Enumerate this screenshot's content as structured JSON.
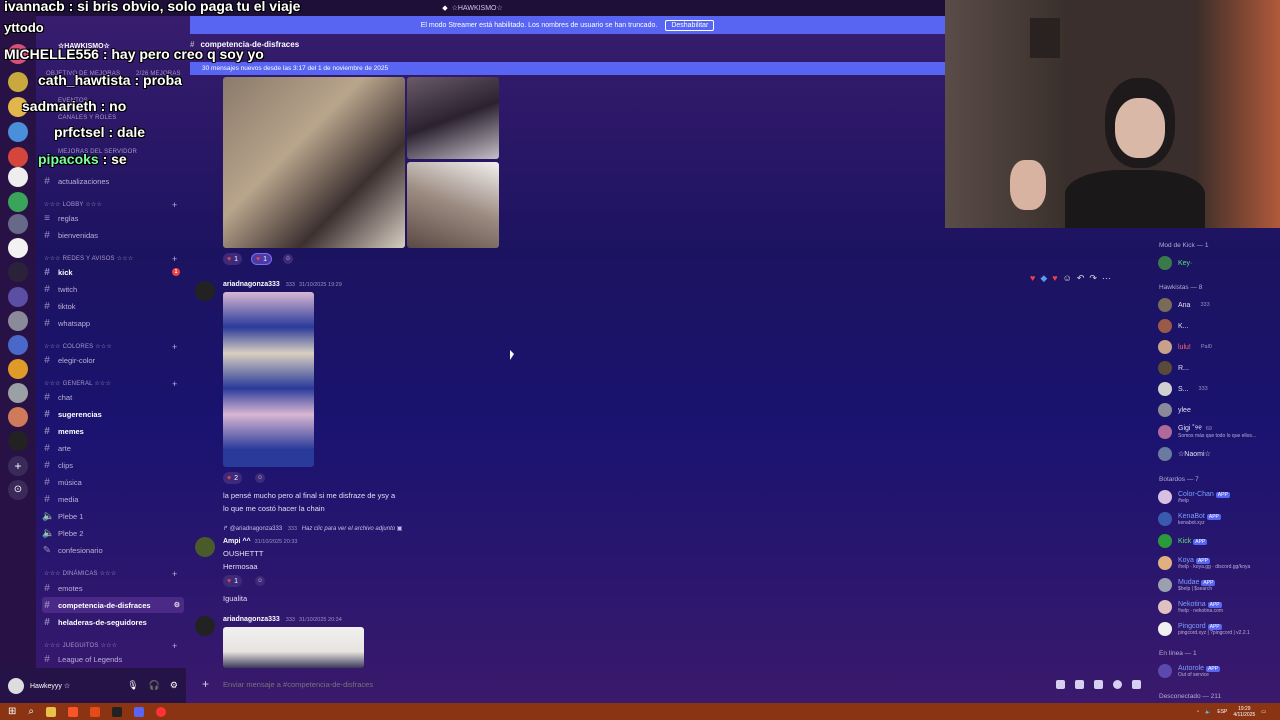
{
  "window": {
    "server_name": "☆HAWKISMO☆",
    "streamer_notice": "El modo Streamer está habilitado. Los nombres de usuario se han truncado.",
    "disable_label": "Deshabilitar"
  },
  "chat_overlay": [
    {
      "user": "ivannacb",
      "text": ": si bris obvio, solo paga tu el viaje"
    },
    {
      "user": "yttodo",
      "text": ""
    },
    {
      "user": "MICHELLE556",
      "text": ": hay pero creo q soy yo"
    },
    {
      "user": "cath_hawtista",
      "text": ": proba"
    },
    {
      "user": "sadmarieth",
      "text": ": no"
    },
    {
      "user": "prfctsel",
      "text": ": dale"
    },
    {
      "user": "pipacoks",
      "text": ": se"
    }
  ],
  "sidebar": {
    "server_title": "☆HAWKISMO☆",
    "hidden_items": [
      "Objetivo de mejoras",
      "Eventos",
      "Canales y roles",
      "Mejoras del servidor"
    ],
    "boost_count": "2/26 Mejoras",
    "categories": [
      {
        "name": "☆☆☆ LOBBY ☆☆☆"
      },
      {
        "name": "☆☆☆ REDES Y AVISOS ☆☆☆"
      },
      {
        "name": "☆☆☆ COLORES ☆☆☆"
      },
      {
        "name": "☆☆☆ GENERAL ☆☆☆"
      },
      {
        "name": "☆☆☆ DINÁMICAS ☆☆☆"
      },
      {
        "name": "☆☆☆ JUEGUITOS ☆☆☆"
      }
    ],
    "channels": [
      "actualizaciones",
      "reglas",
      "bienvenidas",
      "kick",
      "twitch",
      "tiktok",
      "whatsapp",
      "elegir-color",
      "chat",
      "sugerencias",
      "memes",
      "arte",
      "clips",
      "música",
      "media",
      "Plebe 1",
      "Plebe 2",
      "confesionario",
      "emotes",
      "competencia-de-disfraces",
      "heladeras-de-seguidores",
      "League of Legends"
    ],
    "kick_badge": "1"
  },
  "user_panel": {
    "name": "Hawkeyyy ☆"
  },
  "channel": {
    "name": "competencia-de-disfraces",
    "new_messages": "30 mensajes nuevos desde las 3:17 del 1 de noviembre de 2025",
    "composer_placeholder": "Enviar mensaje a #competencia-de-disfraces"
  },
  "messages": [
    {
      "reactions": [
        {
          "emoji": "♥",
          "count": "1"
        },
        {
          "emoji": "♥",
          "count": "1"
        }
      ]
    },
    {
      "author": "ariadnagonza333",
      "tag": "333",
      "time": "31/10/2025 19:29",
      "reactions": [
        {
          "emoji": "♥",
          "count": "2"
        }
      ],
      "text1": "la pensé mucho pero al final si me disfraze de ysy a",
      "text2": "lo que me costó hacer la chain"
    },
    {
      "reply_to": "@ariadnagonza333",
      "reply_tag": "333",
      "reply_text": "Haz clic para ver el archivo adjunto",
      "author": "Ampi ^^",
      "time": "31/10/2025 20:33",
      "text1": "OUSHETTT",
      "text2": "Hermosaa",
      "reactions": [
        {
          "emoji": "♥",
          "count": "1"
        }
      ],
      "text3": "Igualita"
    },
    {
      "author": "ariadnagonza333",
      "tag": "333",
      "time": "31/10/2025 20:34"
    }
  ],
  "members": {
    "groups": [
      {
        "label": "Mod de Kick — 1"
      },
      {
        "label": "Hawkistas — 8"
      },
      {
        "label": "Botardos — 7"
      },
      {
        "label": "En línea — 1"
      },
      {
        "label": "Desconectado — 211"
      }
    ],
    "mods": [
      {
        "name": "Key·"
      }
    ],
    "hawkistas": [
      {
        "name": "Ana",
        "badge": "333"
      },
      {
        "name": "K...",
        "badge": ""
      },
      {
        "name": "lulu!",
        "badge": "Pal0"
      },
      {
        "name": "R...",
        "badge": ""
      },
      {
        "name": "S...",
        "badge": "333"
      },
      {
        "name": "ylee",
        "badge": ""
      },
      {
        "name": "Gigi ˚୨୧",
        "badge": "69",
        "status": "Somos más que todo lo que ellos..."
      },
      {
        "name": "☆Naomi☆",
        "badge": ""
      }
    ],
    "bots": [
      {
        "name": "Color-Chan",
        "tag": "APP",
        "status": "/help"
      },
      {
        "name": "KenaBot",
        "tag": "APP",
        "status": "kenabot.xyz"
      },
      {
        "name": "Kick",
        "tag": "APP",
        "status": ""
      },
      {
        "name": "Koya",
        "tag": "APP",
        "status": "/help · koya.gg · discord.gg/koya"
      },
      {
        "name": "Mudae",
        "tag": "APP",
        "status": "$help | $search"
      },
      {
        "name": "Nekotina",
        "tag": "APP",
        "status": "!help · nekotina.com"
      },
      {
        "name": "Pingcord",
        "tag": "APP",
        "status": "pingcord.xyz | ?pingcord | v2.2.1"
      }
    ],
    "online": [
      {
        "name": "Autorole",
        "tag": "APP",
        "status": "Out of service"
      }
    ]
  },
  "taskbar": {
    "time": "19:29",
    "date": "4/11/2025",
    "lang": "ESP"
  },
  "colors": {
    "accent": "#5865f2",
    "taskbar": "#8a3414",
    "heart": "#ed4245"
  }
}
